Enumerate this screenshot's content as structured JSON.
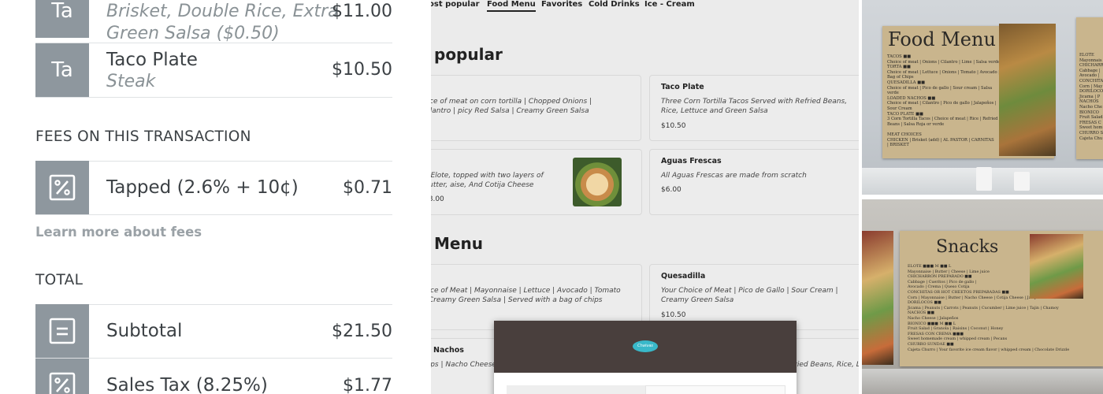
{
  "receipt": {
    "items": [
      {
        "tile": "Ta",
        "name": "Brisket, Double Rice, Extra",
        "sub": "Green Salsa ($0.50)",
        "price": "$11.00"
      },
      {
        "tile": "Ta",
        "name": "Taco Plate",
        "sub": "Steak",
        "price": "$10.50"
      }
    ],
    "fees_heading": "FEES ON THIS TRANSACTION",
    "fee": {
      "name": "Tapped (2.6% + 10¢)",
      "price": "$0.71",
      "icon": "percent-icon"
    },
    "learn_more": "Learn more about fees",
    "total_heading": "TOTAL",
    "subtotal": {
      "name": "Subtotal",
      "price": "$21.50",
      "icon": "document-icon"
    },
    "tax": {
      "name": "Sales Tax (8.25%)",
      "price": "$1.77",
      "icon": "percent-icon"
    }
  },
  "menu": {
    "nav": [
      "ost popular",
      "Food Menu",
      "Favorites",
      "Cold Drinks",
      "Ice - Cream"
    ],
    "active_nav": "Food Menu",
    "section1": "popular",
    "section2": "Menu",
    "cards": {
      "c1": {
        "desc": "oice of meat on corn tortilla | Chopped Onions | Cilantro | picy Red Salsa | Creamy Green Salsa"
      },
      "c2": {
        "title": "Taco Plate",
        "desc": "Three Corn Tortilla Tacos Served with Refried Beans, Rice, Lettuce and Green Salsa",
        "price": "$10.50"
      },
      "c3": {
        "desc": "h Elote, topped with two layers of Butter, aise, And Cotija Cheese",
        "price": "$8.00"
      },
      "c4": {
        "title": "Aguas Frescas",
        "desc": "All Aguas Frescas are made from scratch",
        "price": "$6.00"
      },
      "c5": {
        "desc": "oice of Meat | Mayonnaise | Lettuce | Avocado | Tomato | Creamy Green Salsa | Served with a bag of chips"
      },
      "c6": {
        "title": "Quesadilla",
        "desc": "Your Choice of Meat | Pico de Gallo | Sour Cream | Creamy Green Salsa",
        "price": "$10.50"
      },
      "c7": {
        "title": "Nachos",
        "desc": "hips | Nacho Cheese | Sour Cream | P"
      },
      "c8": {
        "desc": "fried Beans, Rice, Lettuce"
      }
    },
    "modal_logo": "Chaivas"
  },
  "photos": {
    "sign1_title": "Food Menu",
    "sign1_lines": "TACOS ■■\nChoice of meat | Onions | Cilantro | Lime | Salsa verde\nTORTA ■■\nChoice of meat | Lettuce | Onions | Tomato | Avocado |\nBag of Chips\nQUESADILLA ■■\nChoice of meat | Pico de gallo | Sour cream | Salsa\nverde\nLOADED NACHOS ■■\nChoice of meat | Cilantro | Pico de gallo | Jalapeños |\nSour Cream\nTACO PLATE ■■\n3 Corn Tortilla Tacos | Choice of meat | Rice | Refried\nBeans | Salsa Roja or verde\n\nMEAT CHOICES\nCHICKEN | Brisket (add) | AL PASTOR | CARNITAS\n| BRISKET",
    "sign2_title": "Snacks",
    "sign2_lines": "ELOTE ■■■ M ■■ L\nMayonnaise | Butter | Cheese | Lime juice\nCHICHARRON PREPARADO ■■\nCabbage | Cueritos | Pico de gallo |\nAvocado | Crema | Queso Cotija\nCONCHITAS OR HOT CHEETOS PREPARADAS ■■\nCorn | Mayonnaise | Butter | Nacho Cheese | Cotija Cheese | Jalapeños\nDORILOCOS ■■\nJicama | Peanuts | Carrots | Peanuts | Cucumber | Lime juice | Tajin | Chamoy\nNACHOS ■■\nNacho Cheese | Jalapeños\nBIONICO ■■■ M ■■ L\nFruit Salad | Granola | Raisins | Coconut | Honey\nFRESAS CON CREMA ■■■\nSweet homemade cream | whipped cream | Pecans\nCHURRO SUNDAE ■■\nCajeta Churro | Your favorite ice cream flavor | whipped cream | Chocolate Drizzle",
    "sign_right_lines": "ELOTE\nMayonnais\nCHICHARR\nCabbage |\nAvocado |\nCONCHITA\nCorn | May\nDORILOCO\nJicama | P\nNACHOS\nNacho Che\nBIONICO\nFruit Salad\nFRESAS C\nSweet hom\nCHURRO S\nCajeta Chu"
  }
}
